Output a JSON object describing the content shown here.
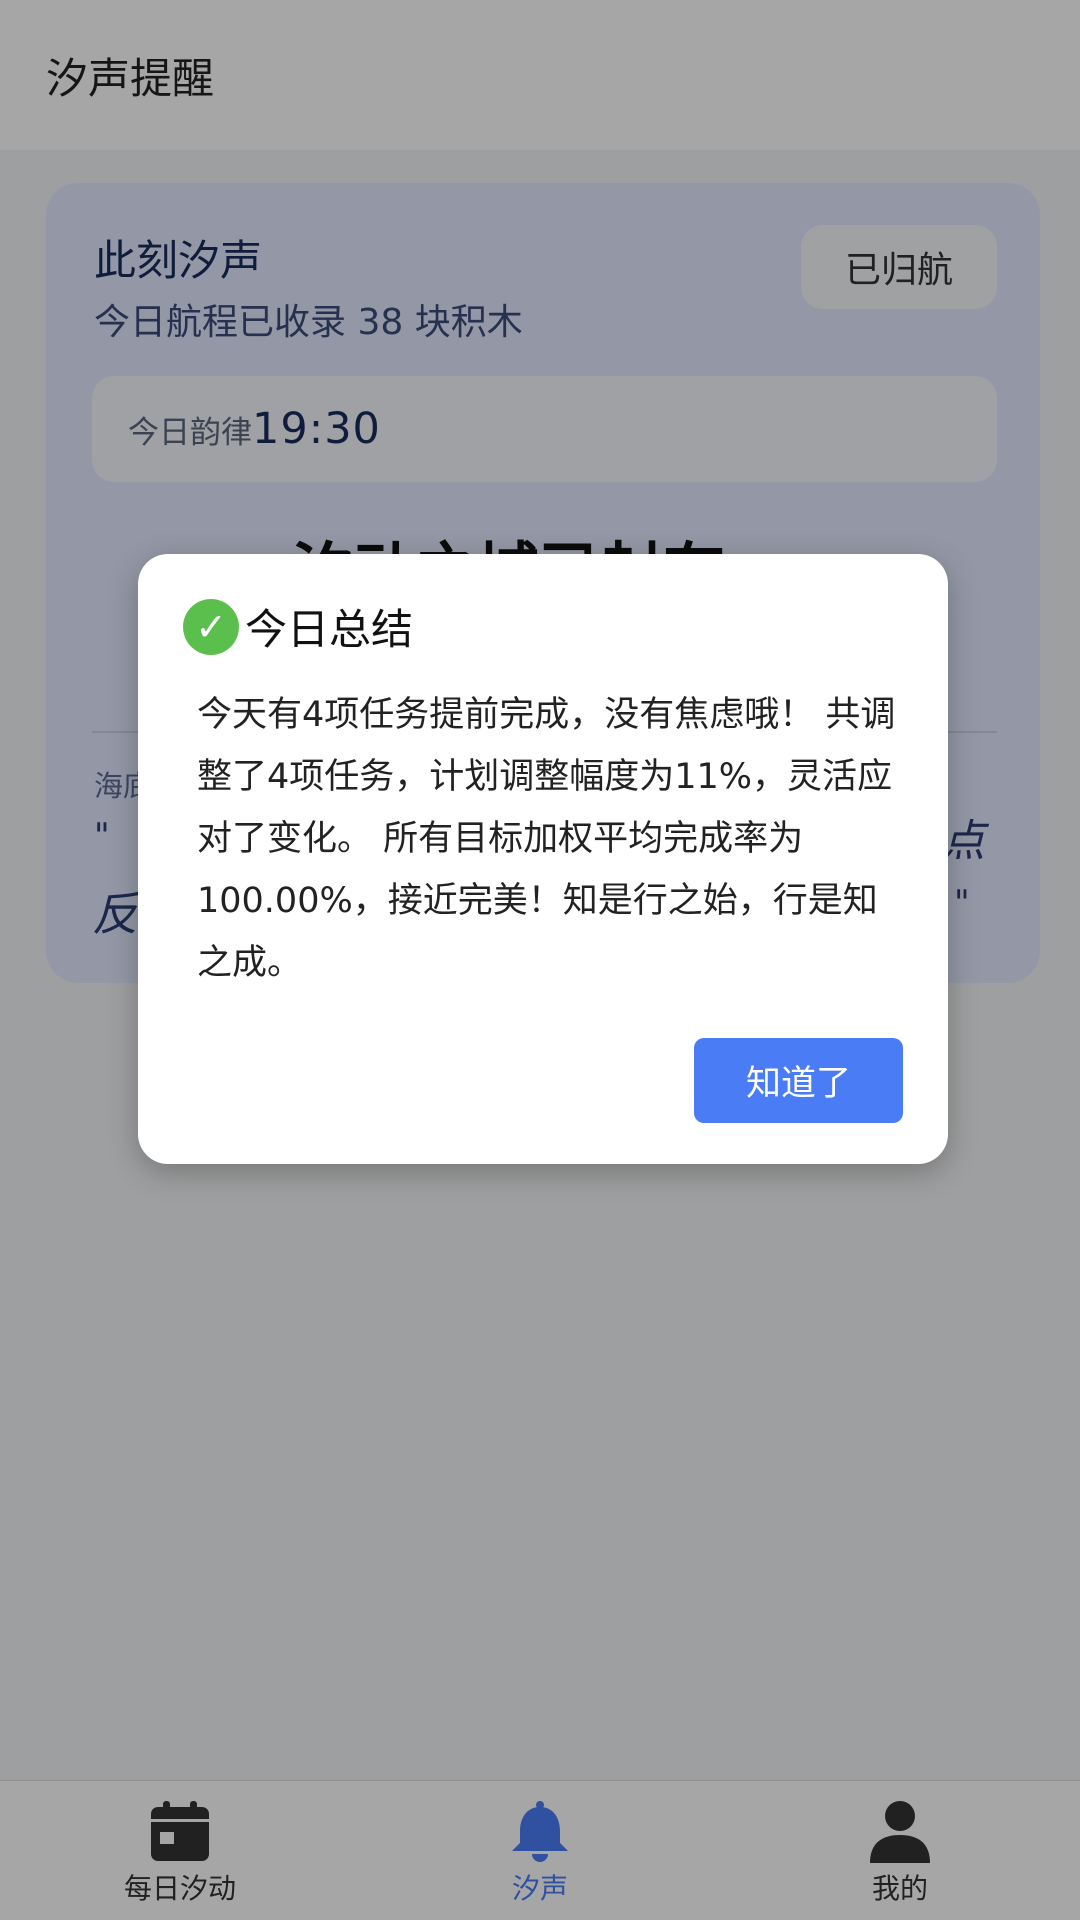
{
  "header": {
    "title": "汐声提醒"
  },
  "card": {
    "title": "此刻汐声",
    "subtitle": "今日航程已收录 38 块积木",
    "status_badge": "已归航",
    "rhythm_label": "今日韵律",
    "rhythm_time": "19:30",
    "headline": "汐动之城已封存",
    "quote_source": "海底",
    "quote_open_mark": "\"",
    "quote_line_fragment": "反",
    "quote_trailing_char": "点",
    "quote_close_mark": "\""
  },
  "dialog": {
    "icon": "check-circle-icon",
    "title": "今日总结",
    "body": "今天有4项任务提前完成，没有焦虑哦！ 共调整了4项任务，计划调整幅度为11%，灵活应对了变化。 所有目标加权平均完成率为100.00%，接近完美！知是行之始，行是知之成。",
    "ok_label": "知道了"
  },
  "tabbar": {
    "items": [
      {
        "label": "每日汐动",
        "icon": "calendar-icon",
        "active": false
      },
      {
        "label": "汐声",
        "icon": "bell-icon",
        "active": true
      },
      {
        "label": "我的",
        "icon": "user-icon",
        "active": false
      }
    ]
  },
  "colors": {
    "accent": "#4a7cf6",
    "check_green": "#5bbf4e",
    "card_bg": "#e3eaff",
    "tab_inactive": "#333333"
  }
}
